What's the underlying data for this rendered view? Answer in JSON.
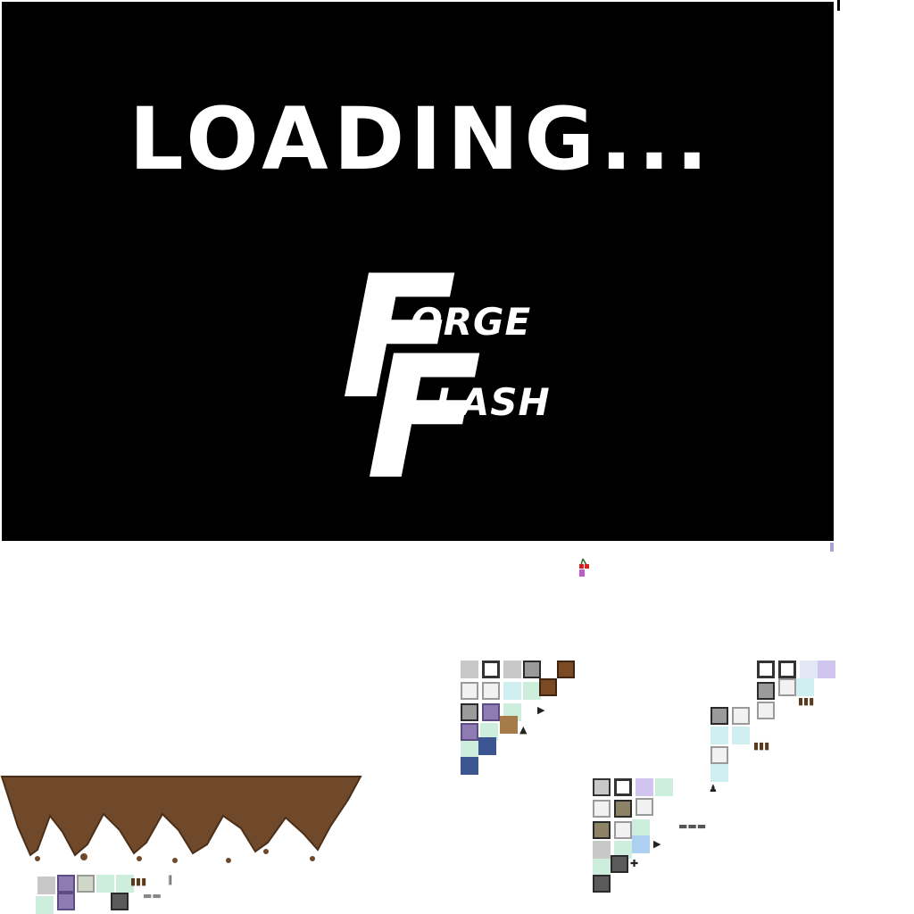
{
  "loading": {
    "text": "LOADING..."
  },
  "logo": {
    "line1_initial": "F",
    "line1_rest": "ORGE",
    "line2_initial": "F",
    "line2_rest": "LASH"
  },
  "colors": {
    "canvas": "#000000",
    "text": "#ffffff",
    "ground": "#70492a"
  },
  "icons": [
    "cursor-icon",
    "cherry-sprite",
    "tree-sprite",
    "cloud-sprite",
    "arrow-sprite",
    "crate-sprite"
  ]
}
